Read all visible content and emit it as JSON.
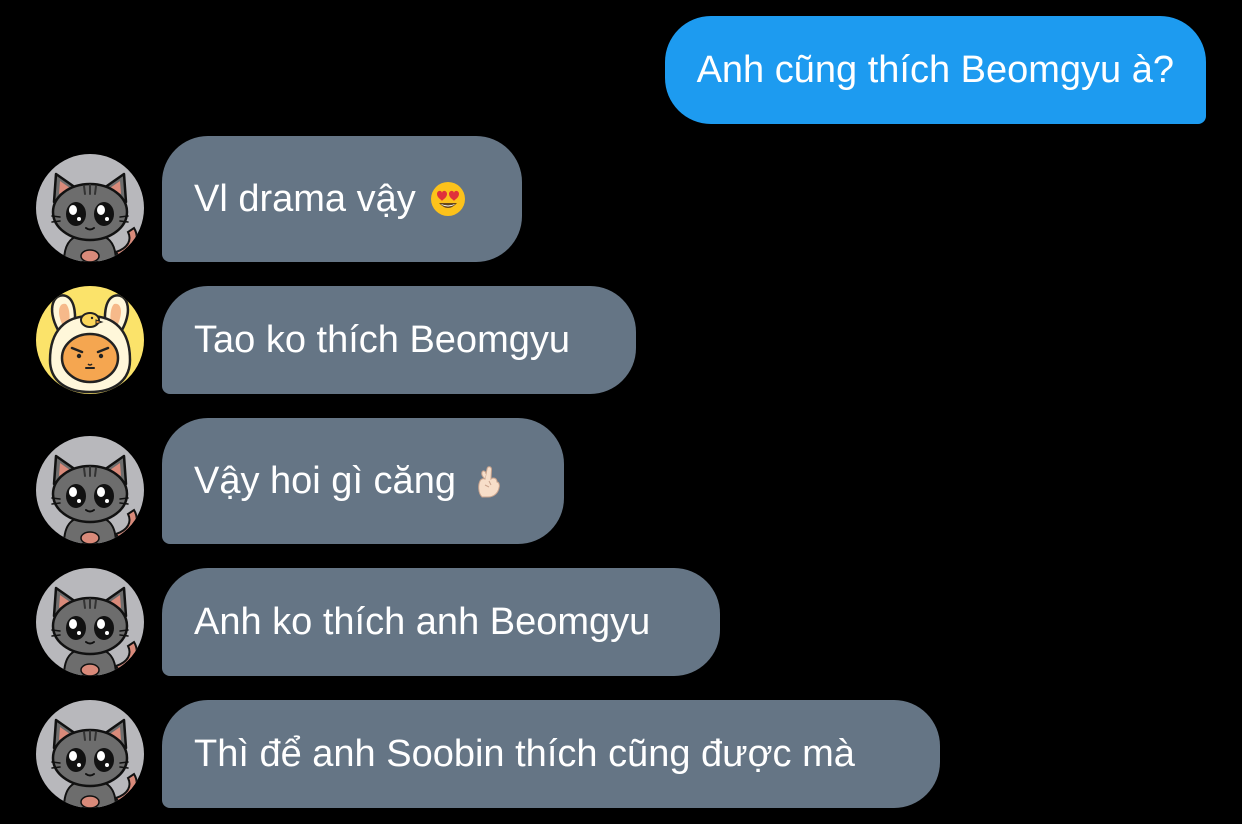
{
  "colors": {
    "background": "#000000",
    "outgoing_bubble": "#1d9bf0",
    "incoming_bubble": "#657585",
    "text": "#ffffff"
  },
  "messages": [
    {
      "direction": "outgoing",
      "text": "Anh cũng thích Beomgyu à?",
      "emoji": null,
      "avatar": null
    },
    {
      "direction": "incoming",
      "text": "Vl drama vậy",
      "emoji": "heart-eyes-emoji",
      "avatar": "gray-cat-avatar"
    },
    {
      "direction": "incoming",
      "text": "Tao ko thích Beomgyu",
      "emoji": null,
      "avatar": "yellow-bunny-avatar"
    },
    {
      "direction": "incoming",
      "text": "Vậy hoi gì căng",
      "emoji": "finger-heart-emoji",
      "avatar": "gray-cat-avatar"
    },
    {
      "direction": "incoming",
      "text": "Anh ko thích anh Beomgyu",
      "emoji": null,
      "avatar": "gray-cat-avatar"
    },
    {
      "direction": "incoming",
      "text": "Thì để anh Soobin thích cũng được mà",
      "emoji": null,
      "avatar": "gray-cat-avatar"
    }
  ]
}
